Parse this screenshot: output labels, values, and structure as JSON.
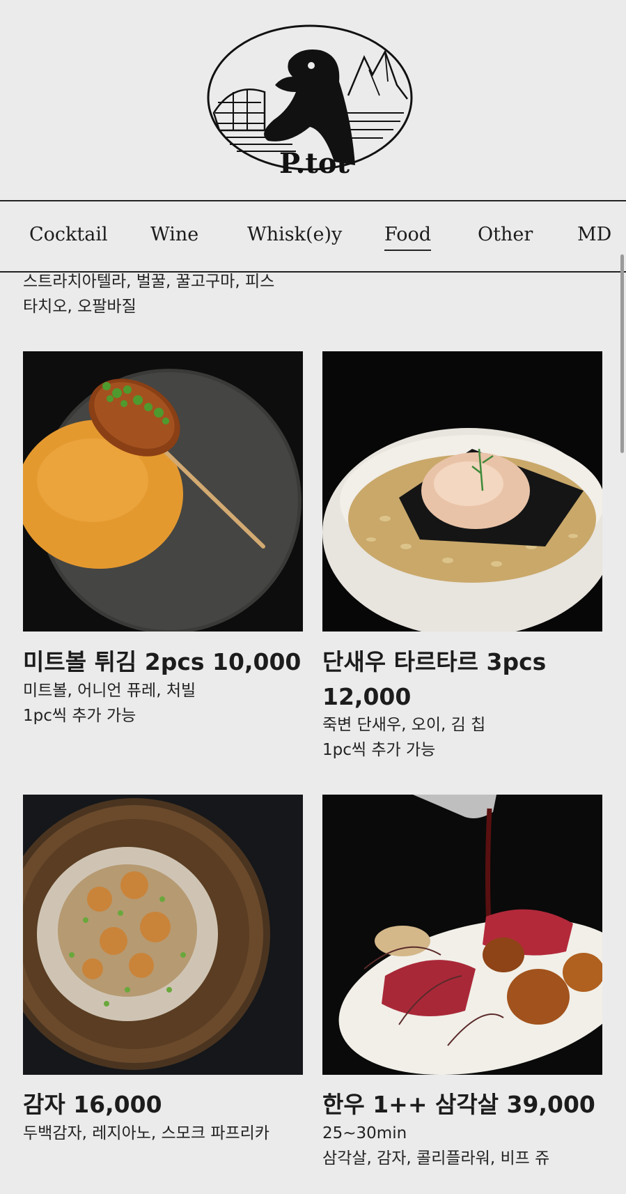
{
  "brand": {
    "logo_text": "P.tot"
  },
  "nav": {
    "tabs": [
      {
        "label": "Cocktail"
      },
      {
        "label": "Wine"
      },
      {
        "label": "Whisk(e)y"
      },
      {
        "label": "Food",
        "active": true
      },
      {
        "label": "Other"
      },
      {
        "label": "MD"
      }
    ]
  },
  "top_item": {
    "desc_line1": "스트라치아텔라, 벌꿀, 꿀고구마, 피스",
    "desc_line2": "타치오, 오팔바질"
  },
  "items": [
    {
      "title": "미트볼 튀김 2pcs 10,000",
      "lines": [
        "미트볼, 어니언 퓨레, 처빌",
        "1pc씩 추가 가능"
      ],
      "image": "fried-meatball-photo"
    },
    {
      "title_line1": "단새우 타르타르 3pcs",
      "title_line2": "12,000",
      "lines": [
        "죽변 단새우, 오이, 김 칩",
        "1pc씩 추가 가능"
      ],
      "image": "shrimp-tartare-photo"
    },
    {
      "title": "감자 16,000",
      "lines": [
        "두백감자, 레지아노, 스모크 파프리카"
      ],
      "image": "potato-dish-photo"
    },
    {
      "title": "한우 1++ 삼각살 39,000",
      "lines": [
        "25~30min",
        "삼각살, 감자, 콜리플라워, 비프 쥬"
      ],
      "image": "hanwoo-steak-photo"
    }
  ]
}
